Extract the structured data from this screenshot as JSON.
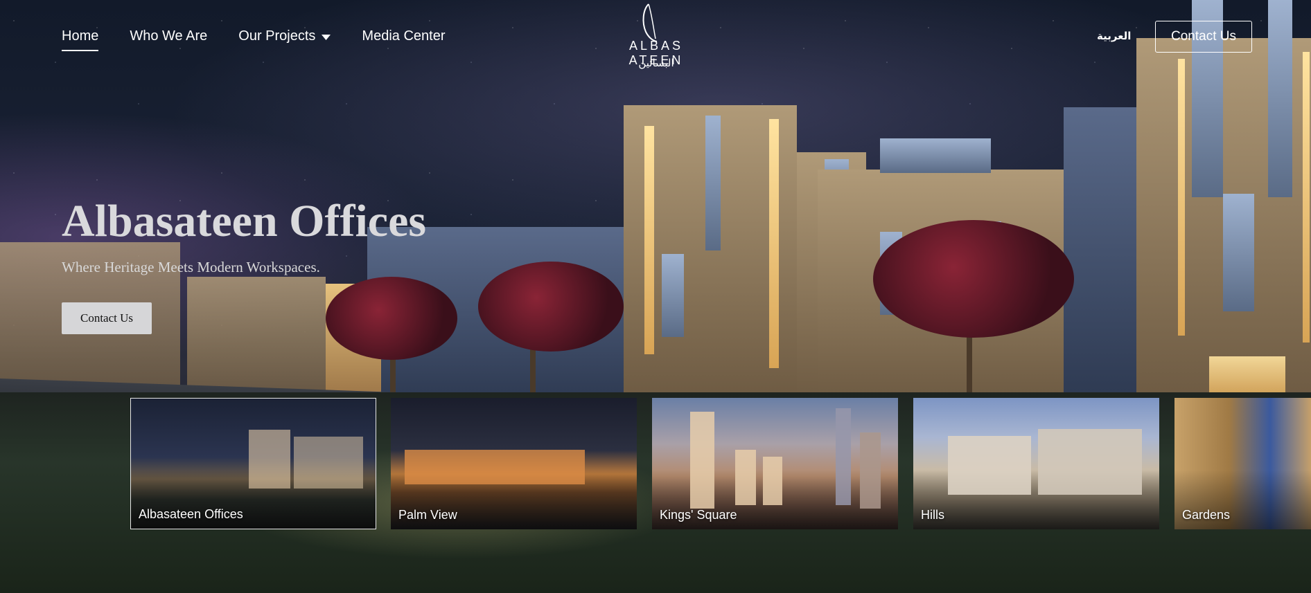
{
  "nav": {
    "links": [
      {
        "label": "Home",
        "active": true
      },
      {
        "label": "Who We Are"
      },
      {
        "label": "Our Projects",
        "has_dropdown": true
      },
      {
        "label": "Media Center"
      }
    ],
    "language_toggle": "العربية",
    "contact_label": "Contact Us"
  },
  "logo": {
    "english": "ALBAS ATEEN",
    "arabic": "البساتين"
  },
  "hero": {
    "title": "Albasateen Offices",
    "subtitle": "Where Heritage Meets Modern Workspaces.",
    "cta_label": "Contact Us"
  },
  "projects": [
    {
      "label": "Albasateen Offices",
      "selected": true
    },
    {
      "label": "Palm View"
    },
    {
      "label": "Kings' Square"
    },
    {
      "label": "Hills"
    },
    {
      "label": "Gardens"
    }
  ],
  "icons": {
    "dropdown": "chevron-down-icon"
  }
}
